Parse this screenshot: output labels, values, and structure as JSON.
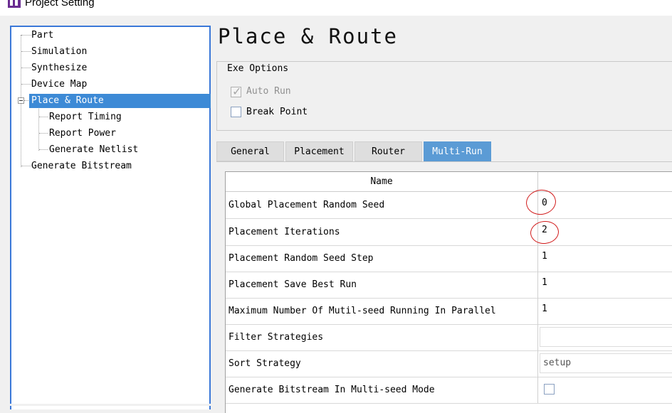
{
  "window": {
    "title": "Project Setting"
  },
  "tree": {
    "items": [
      {
        "label": "Part"
      },
      {
        "label": "Simulation"
      },
      {
        "label": "Synthesize"
      },
      {
        "label": "Device Map"
      },
      {
        "label": "Place & Route",
        "selected": true,
        "expanded": true
      },
      {
        "label": "Report Timing"
      },
      {
        "label": "Report Power"
      },
      {
        "label": "Generate Netlist"
      },
      {
        "label": "Generate Bitstream"
      }
    ]
  },
  "page": {
    "title": "Place & Route"
  },
  "exe_options": {
    "label": "Exe Options",
    "auto_run": {
      "label": "Auto Run",
      "checked": true,
      "disabled": true
    },
    "break_point": {
      "label": "Break Point",
      "checked": false
    }
  },
  "tabs": [
    {
      "label": "General"
    },
    {
      "label": "Placement"
    },
    {
      "label": "Router"
    },
    {
      "label": "Multi-Run",
      "active": true
    }
  ],
  "table": {
    "header": {
      "name": "Name",
      "value": ""
    },
    "rows": [
      {
        "name": "Global Placement Random Seed",
        "value": "0"
      },
      {
        "name": "Placement Iterations",
        "value": "2"
      },
      {
        "name": "Placement Random Seed Step",
        "value": "1"
      },
      {
        "name": "Placement Save Best Run",
        "value": "1"
      },
      {
        "name": "Maximum Number Of Mutil-seed Running In Parallel",
        "value": "1"
      },
      {
        "name": "Filter Strategies",
        "value": ""
      },
      {
        "name": "Sort Strategy",
        "value": "setup"
      },
      {
        "name": "Generate Bitstream In Multi-seed Mode",
        "value": false
      }
    ]
  },
  "colors": {
    "selection": "#3d8ad6",
    "tab_active": "#5b9bd5",
    "annotation": "#d11a1a"
  }
}
